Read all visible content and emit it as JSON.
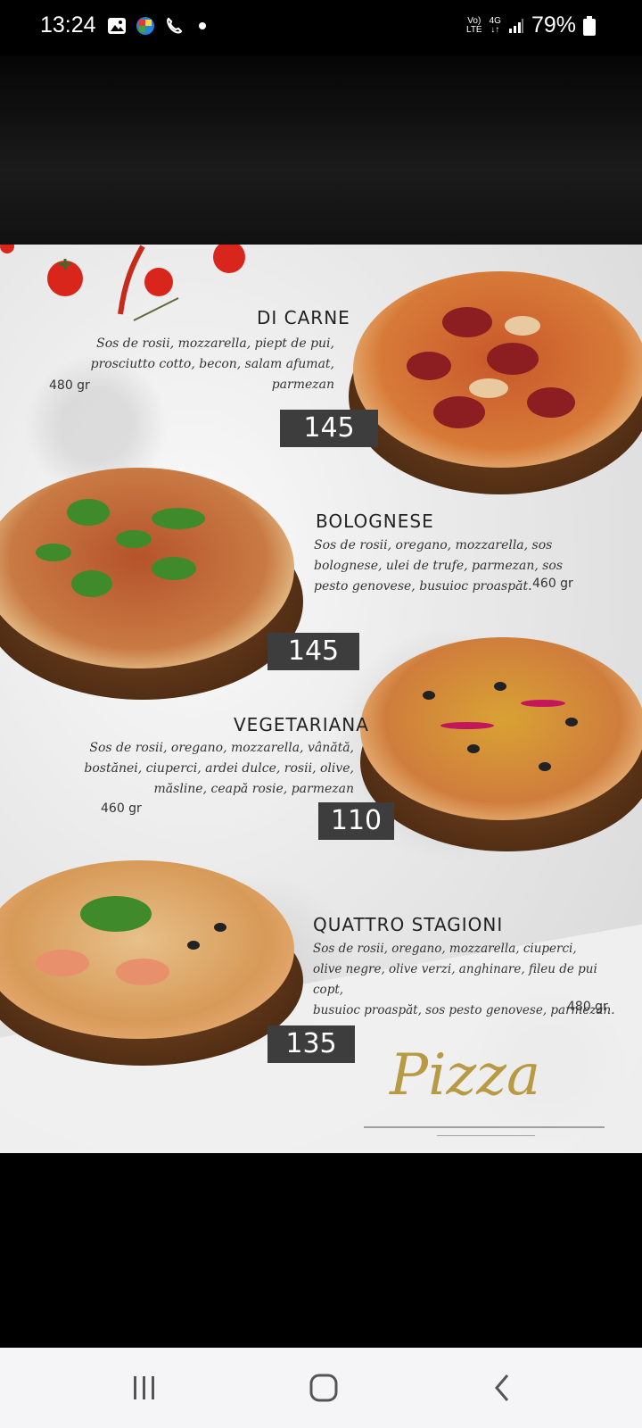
{
  "status": {
    "time": "13:24",
    "network_top": "Vo)",
    "network_bottom": "LTE",
    "net_type": "4G",
    "battery": "79%",
    "icons": [
      "gallery-icon",
      "app-icon",
      "call-icon",
      "dot-icon",
      "signal-icon",
      "battery-icon"
    ]
  },
  "menu": {
    "items": [
      {
        "name": "DI CARNE",
        "desc1": "Sos de rosii, mozzarella, piept de pui,",
        "desc2": "prosciutto cotto, becon, salam afumat, parmezan",
        "desc3": "",
        "weight": "480 gr",
        "price": "145"
      },
      {
        "name": "BOLOGNESE",
        "desc1": "Sos de rosii, oregano, mozzarella, sos",
        "desc2": "bolognese, ulei de trufe, parmezan, sos",
        "desc3": "pesto genovese, busuioc proaspăt.",
        "weight": "460 gr",
        "price": "145"
      },
      {
        "name": "VEGETARIANA",
        "desc1": "Sos de rosii, oregano, mozzarella, vânătă,",
        "desc2": "bostănei, ciuperci, ardei dulce, rosii, olive,",
        "desc3": "măsline, ceapă rosie, parmezan",
        "weight": "460 gr",
        "price": "110"
      },
      {
        "name": "QUATTRO STAGIONI",
        "desc1": "Sos de rosii, oregano, mozzarella, ciuperci,",
        "desc2": "olive negre, olive verzi, anghinare, fileu de pui copt,",
        "desc3": "busuioc proaspăt, sos pesto genovese, parmezan.",
        "weight": "480 gr",
        "price": "135"
      }
    ],
    "logo": "Pizza"
  },
  "nav": {
    "icons": [
      "recents-icon",
      "home-icon",
      "back-icon"
    ]
  }
}
